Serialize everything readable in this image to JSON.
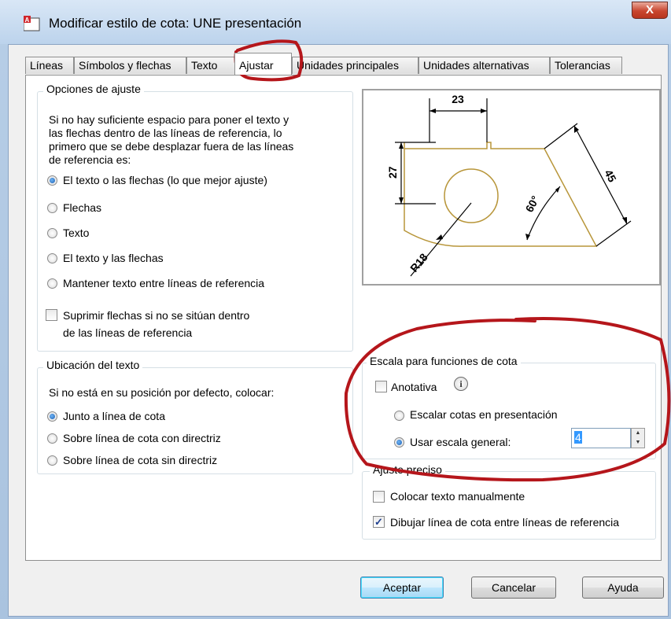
{
  "window": {
    "title": "Modificar estilo de cota: UNE presentación",
    "close_label": "X"
  },
  "tabs": [
    {
      "label": "Líneas"
    },
    {
      "label": "Símbolos y flechas"
    },
    {
      "label": "Texto"
    },
    {
      "label": "Ajustar",
      "active": true
    },
    {
      "label": "Unidades principales"
    },
    {
      "label": "Unidades alternativas"
    },
    {
      "label": "Tolerancias"
    }
  ],
  "fit_options": {
    "legend": "Opciones de ajuste",
    "description": [
      "Si no hay suficiente espacio para poner el texto y",
      "las flechas dentro de las líneas de referencia, lo",
      "primero que se debe desplazar fuera de las líneas",
      "de referencia es:"
    ],
    "radios": [
      {
        "label": "El texto o las flechas (lo que mejor ajuste)",
        "checked": true
      },
      {
        "label": "Flechas",
        "checked": false
      },
      {
        "label": "Texto",
        "checked": false
      },
      {
        "label": "El texto y las flechas",
        "checked": false
      },
      {
        "label": "Mantener texto entre líneas de referencia",
        "checked": false
      }
    ],
    "suppress_checkbox": {
      "label_line1": "Suprimir flechas si no se sitúan dentro",
      "label_line2": "de las líneas de referencia",
      "checked": false
    }
  },
  "text_placement": {
    "legend": "Ubicación del texto",
    "description": "Si no está en su posición por defecto, colocar:",
    "radios": [
      {
        "label": "Junto a línea de cota",
        "checked": true
      },
      {
        "label": "Sobre línea de cota con directriz",
        "checked": false
      },
      {
        "label": "Sobre línea de cota sin directriz",
        "checked": false
      }
    ]
  },
  "preview": {
    "dim_23": "23",
    "dim_27": "27",
    "dim_45": "45",
    "dim_60": "60°",
    "dim_r18": "R18"
  },
  "scale": {
    "legend": "Escala para funciones de cota",
    "annotative_label": "Anotativa",
    "annotative_checked": false,
    "info_glyph": "i",
    "radio_layout": {
      "label": "Escalar cotas en presentación",
      "checked": false
    },
    "radio_overall": {
      "label": "Usar escala general:",
      "checked": true
    },
    "overall_value": "4"
  },
  "fine_tuning": {
    "legend": "Ajuste preciso",
    "place_manual": {
      "label": "Colocar texto manualmente",
      "checked": false
    },
    "draw_dimline": {
      "label": "Dibujar línea de cota entre líneas de referencia",
      "checked": true
    }
  },
  "buttons": {
    "ok": "Aceptar",
    "cancel": "Cancelar",
    "help": "Ayuda"
  },
  "colors": {
    "annotation_red": "#b5161b",
    "drawing_gold": "#b8963a"
  }
}
